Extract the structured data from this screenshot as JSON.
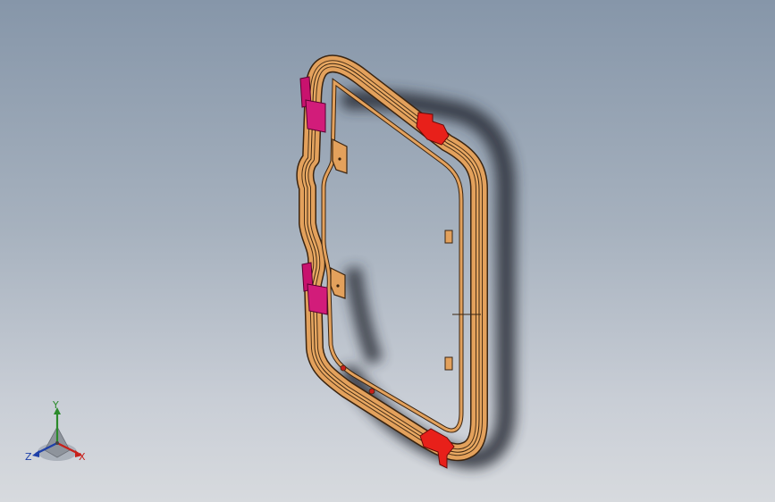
{
  "viewport": {
    "background_top": "#8696a9",
    "background_bottom": "#d7dade"
  },
  "model": {
    "part_color": "#e3a15c",
    "part_edge_color": "#3a2410",
    "clip_color": "#e8201a",
    "tab_color": "#c8126e",
    "shadow_color": "#2a2f37"
  },
  "triad": {
    "x_label": "X",
    "y_label": "Y",
    "z_label": "Z",
    "x_color": "#c8201a",
    "y_color": "#2b8a2b",
    "z_color": "#1d3fa8"
  }
}
